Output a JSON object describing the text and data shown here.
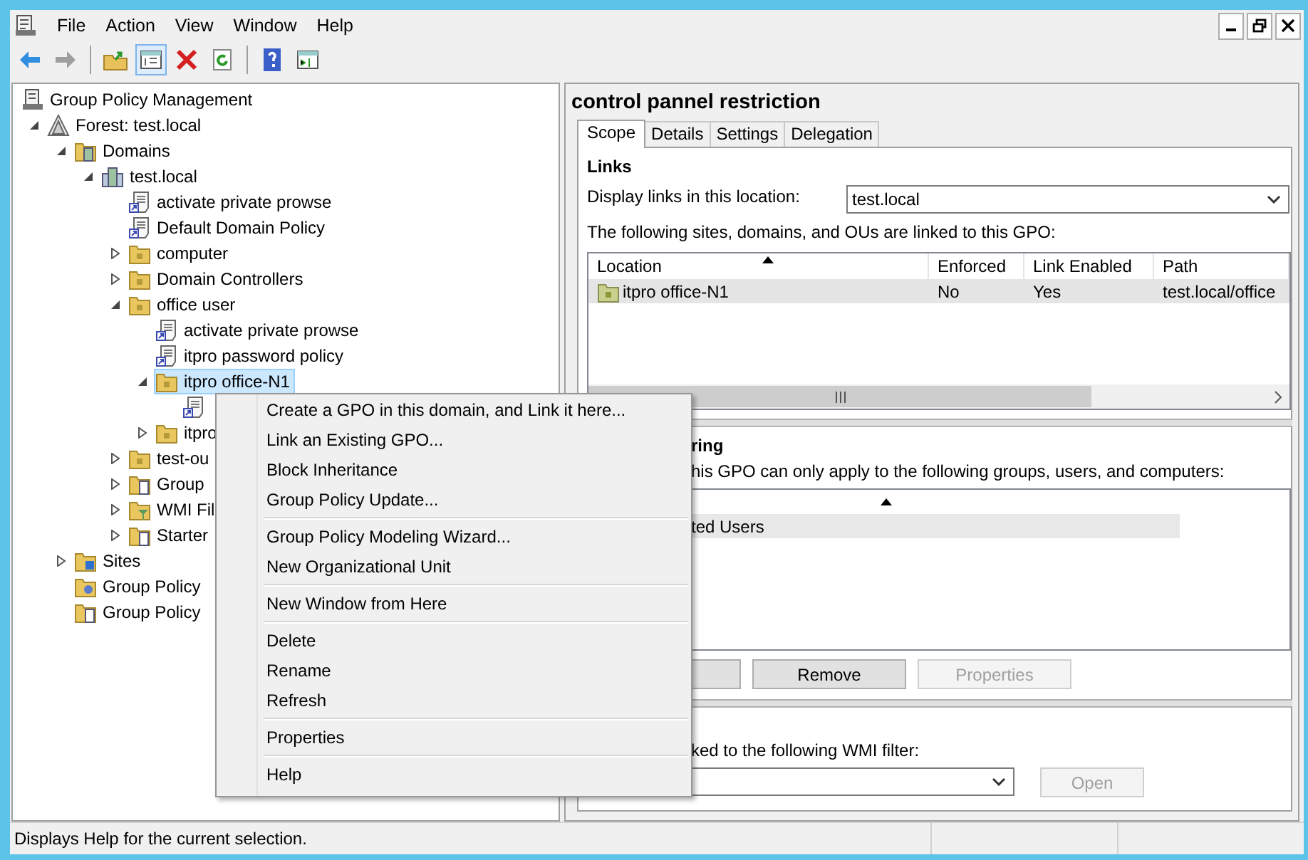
{
  "menu_bar": [
    "File",
    "Action",
    "View",
    "Window",
    "Help"
  ],
  "toolbar": [
    [
      {
        "kind": "back",
        "disabled": false,
        "pressed": false
      },
      {
        "kind": "forward",
        "disabled": true,
        "pressed": false
      }
    ],
    [
      {
        "kind": "up",
        "disabled": false,
        "pressed": false
      },
      {
        "kind": "tree-toggle",
        "disabled": false,
        "pressed": true
      },
      {
        "kind": "delete",
        "disabled": false,
        "pressed": false
      },
      {
        "kind": "refresh",
        "disabled": false,
        "pressed": false
      }
    ],
    [
      {
        "kind": "help",
        "disabled": false,
        "pressed": false
      },
      {
        "kind": "action-pane",
        "disabled": false,
        "pressed": false
      }
    ]
  ],
  "tree": [
    {
      "label": "Group Policy Management",
      "kind": "console",
      "selected": false,
      "children": [
        {
          "label": "Forest: test.local",
          "kind": "forest",
          "expanded": true,
          "selected": false,
          "children": [
            {
              "label": "Domains",
              "kind": "domains",
              "expanded": true,
              "selected": false,
              "children": [
                {
                  "label": "test.local",
                  "kind": "domain",
                  "expanded": true,
                  "selected": false,
                  "children": [
                    {
                      "label": "activate private prowse",
                      "kind": "gpo",
                      "selected": false
                    },
                    {
                      "label": "Default Domain Policy",
                      "kind": "gpo",
                      "selected": false
                    },
                    {
                      "label": "computer",
                      "kind": "ou",
                      "expanded": false,
                      "selected": false
                    },
                    {
                      "label": "Domain Controllers",
                      "kind": "ou",
                      "expanded": false,
                      "selected": false
                    },
                    {
                      "label": "office user",
                      "kind": "ou",
                      "expanded": true,
                      "selected": false,
                      "children": [
                        {
                          "label": "activate private prowse",
                          "kind": "gpo",
                          "selected": false
                        },
                        {
                          "label": "itpro password policy",
                          "kind": "gpo",
                          "selected": false
                        },
                        {
                          "label": "itpro office-N1",
                          "kind": "ou",
                          "expanded": true,
                          "selected": true,
                          "children": [
                            {
                              "kind": "gpo",
                              "selected": false
                            }
                          ]
                        },
                        {
                          "label": "itpro",
                          "kind": "ou",
                          "expanded": false,
                          "selected": false
                        }
                      ]
                    },
                    {
                      "label": "test-ou",
                      "kind": "ou",
                      "expanded": false,
                      "selected": false
                    },
                    {
                      "label": "Group",
                      "kind": "gpo-folder",
                      "expanded": false,
                      "selected": false
                    },
                    {
                      "label": "WMI Fil",
                      "kind": "wmi",
                      "expanded": false,
                      "selected": false
                    },
                    {
                      "label": "Starter",
                      "kind": "starter",
                      "expanded": false,
                      "selected": false
                    }
                  ]
                }
              ]
            },
            {
              "label": "Sites",
              "kind": "sites",
              "expanded": false,
              "selected": false
            },
            {
              "label": "Group Policy",
              "kind": "modeling",
              "selected": false
            },
            {
              "label": "Group Policy",
              "kind": "results",
              "selected": false
            }
          ]
        }
      ]
    }
  ],
  "gpo": {
    "title": "control pannel restriction",
    "tabs": [
      {
        "label": "Scope",
        "selected": true
      },
      {
        "label": "Details",
        "selected": false
      },
      {
        "label": "Settings",
        "selected": false
      },
      {
        "label": "Delegation",
        "selected": false
      }
    ],
    "links": {
      "heading": "Links",
      "location_label": "Display links in this location:",
      "location_value": "test.local",
      "intro": "The following sites, domains, and OUs are linked to this GPO:",
      "columns": [
        "Location",
        "Enforced",
        "Link Enabled",
        "Path"
      ],
      "rows": [
        {
          "cells": [
            "itpro office-N1",
            "No",
            "Yes",
            "test.local/office"
          ]
        }
      ]
    },
    "security": {
      "heading": "ring",
      "intro": "his GPO can only apply to the following groups, users, and computers:",
      "rows": [
        "ted Users"
      ],
      "buttons": [
        {
          "label": "Remove",
          "disabled": false
        },
        {
          "label": "Properties",
          "disabled": true
        }
      ]
    },
    "wmi": {
      "intro": "ked to the following WMI filter:",
      "button": {
        "label": "Open",
        "disabled": true
      }
    }
  },
  "context_menu": {
    "groups": [
      [
        "Create a GPO in this domain, and Link it here...",
        "Link an Existing GPO...",
        "Block Inheritance",
        "Group Policy Update..."
      ],
      [
        "Group Policy Modeling Wizard...",
        "New Organizational Unit"
      ],
      [
        "New Window from Here"
      ],
      [
        "Delete",
        "Rename",
        "Refresh"
      ],
      [
        "Properties"
      ],
      [
        "Help"
      ]
    ]
  },
  "status_bar": "Displays Help for the current selection."
}
